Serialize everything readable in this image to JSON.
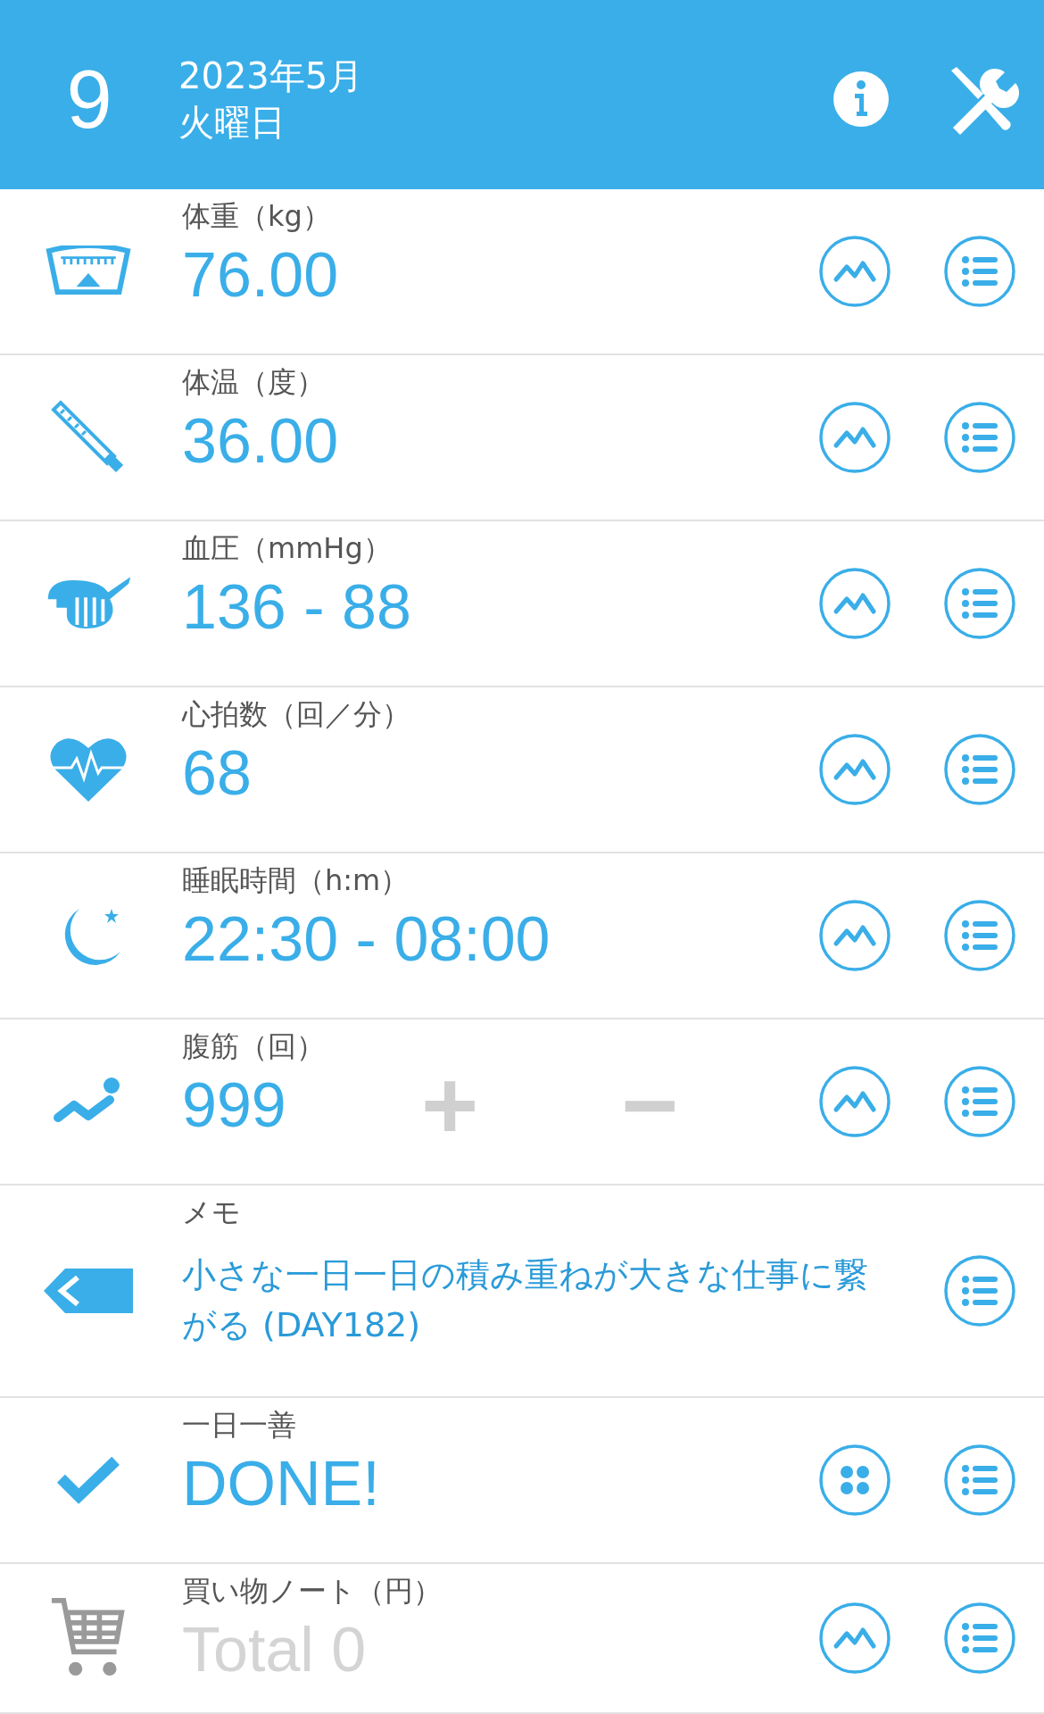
{
  "header": {
    "day": "9",
    "month": "2023年5月",
    "weekday": "火曜日"
  },
  "rows": [
    {
      "kind": "value",
      "label": "体重（kg）",
      "value": "76.00",
      "muted": false
    },
    {
      "kind": "value",
      "label": "体温（度）",
      "value": "36.00",
      "muted": false
    },
    {
      "kind": "value",
      "label": "血圧（mmHg）",
      "value": "136 - 88",
      "muted": false
    },
    {
      "kind": "value",
      "label": "心拍数（回／分）",
      "value": "68",
      "muted": false
    },
    {
      "kind": "value",
      "label": "睡眠時間（h:m）",
      "value": "22:30 - 08:00",
      "muted": false
    },
    {
      "kind": "counter",
      "label": "腹筋（回）",
      "value": "999",
      "muted": false,
      "plus": "+",
      "minus": "−"
    },
    {
      "kind": "memo",
      "label": "メモ",
      "value": "小さな一日一日の積み重ねが大きな仕事に繋がる (DAY182)",
      "muted": false
    },
    {
      "kind": "good",
      "label": "一日一善",
      "value": "DONE!",
      "muted": false
    },
    {
      "kind": "value",
      "label": "買い物ノート（円）",
      "value": "Total 0",
      "muted": true
    }
  ]
}
